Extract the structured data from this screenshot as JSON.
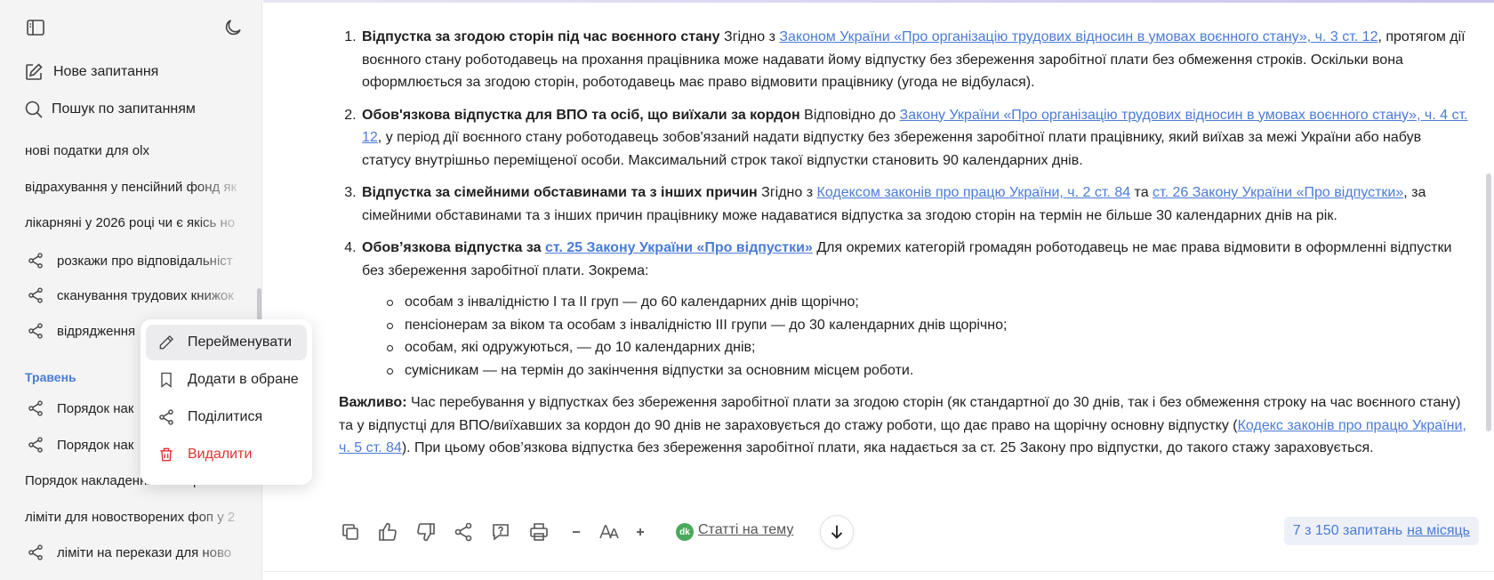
{
  "sidebar": {
    "toggle_icon": "sidebar-toggle-icon",
    "theme_icon": "moon-icon",
    "new_question": "Нове запитання",
    "search": "Пошук по запитанням",
    "history": [
      {
        "label": "нові податки для olx",
        "shared": false
      },
      {
        "label": "відрахування у пенсійний фонд як",
        "shared": false
      },
      {
        "label": "лікарняні у 2026 році чи є якісь но",
        "shared": false
      },
      {
        "label": "розкажи про відповідальніст",
        "shared": true
      },
      {
        "label": "сканування трудових книжок",
        "shared": true
      },
      {
        "label": "відрядження",
        "shared": true
      }
    ],
    "month_label": "Травень",
    "history_may": [
      {
        "label": "Порядок нак",
        "shared": true
      },
      {
        "label": "Порядок нак",
        "shared": true
      },
      {
        "label": "Порядок накладення кваліфікова",
        "shared": false
      },
      {
        "label": "ліміти для новостворених фоп у 2",
        "shared": false
      },
      {
        "label": "ліміти на перекази для ново",
        "shared": true
      }
    ]
  },
  "context_menu": {
    "rename": "Перейменувати",
    "bookmark": "Додати в обране",
    "share": "Поділитися",
    "delete": "Видалити",
    "delete_color": "#e0342f"
  },
  "content": {
    "items": [
      {
        "title": "Відпустка за згодою сторін під час воєнного стану",
        "pre_link": " Згідно з ",
        "link": "Законом України «Про організацію трудових відносин в умовах воєнного стану», ч. 3 ст. 12",
        "post": ", протягом дії воєнного стану роботодавець на прохання працівника може надавати йому відпустку без збереження заробітної плати без обмеження строків. Оскільки вона оформлюється за згодою сторін, роботодавець має право відмовити працівнику (угода не відбулася)."
      },
      {
        "title": "Обов'язкова відпустка для ВПО та осіб, що виїхали за кордон",
        "pre_link": " Відповідно до ",
        "link": "Закону України «Про організацію трудових відносин в умовах воєнного стану», ч. 4 ст. 12",
        "post": ", у період дії воєнного стану роботодавець зобов'язаний надати відпустку без збереження заробітної плати працівнику, який виїхав за межі України або набув статусу внутрішньо переміщеної особи. Максимальний строк такої відпустки становить 90 календарних днів."
      },
      {
        "title": "Відпустка за сімейними обставинами та з інших причин",
        "pre_link": " Згідно з ",
        "link": "Кодексом законів про працю України, ч. 2 ст. 84",
        "mid": " та ",
        "link2": "ст. 26 Закону України «Про відпустки»",
        "post": ", за сімейними обставинами та з інших причин працівнику може надаватися відпустка за згодою сторін на термін не більше 30 календарних днів на рік."
      },
      {
        "title": "Обов’язкова відпустка за ",
        "link": "ст. 25 Закону України «Про відпустки»",
        "post": " Для окремих категорій громадян роботодавець не має права відмовити в оформленні відпустки без збереження заробітної плати. Зокрема:",
        "sub": [
          "особам з інвалідністю I та II груп — до 60 календарних днів щорічно;",
          "пенсіонерам за віком та особам з інвалідністю III групи — до 30 календарних днів щорічно;",
          "особам, які одружуються, — до 10 календарних днів;",
          "сумісникам — на термін до закінчення відпустки за основним місцем роботи."
        ]
      }
    ],
    "important_label": "Важливо:",
    "important_text": " Час перебування у відпустках без збереження заробітної плати за згодою сторін (як стандартної до 30 днів, так і без обмеження строку на час воєнного стану) та у відпустці для ВПО/виїхавших за кордон до 90 днів не зараховується до стажу роботи, що дає право на щорічну основну відпустку (",
    "important_link": "Кодекс законів про працю України, ч. 5 ст. 84",
    "important_post": "). При цьому обов’язкова відпустка без збереження заробітної плати, яка надається за ст. 25 Закону про відпустки, до такого стажу зараховується."
  },
  "toolbar": {
    "icons": [
      "copy-icon",
      "thumbs-up-icon",
      "thumbs-down-icon",
      "share-icon",
      "feedback-icon",
      "print-icon",
      "font-decrease-icon",
      "font-size-icon",
      "font-increase-icon"
    ],
    "dk_badge": "dk",
    "articles": "Статті на тему",
    "quota_text": "7 з 150 запитань",
    "quota_link": "на місяць",
    "accent_color": "#4a7bd8"
  }
}
